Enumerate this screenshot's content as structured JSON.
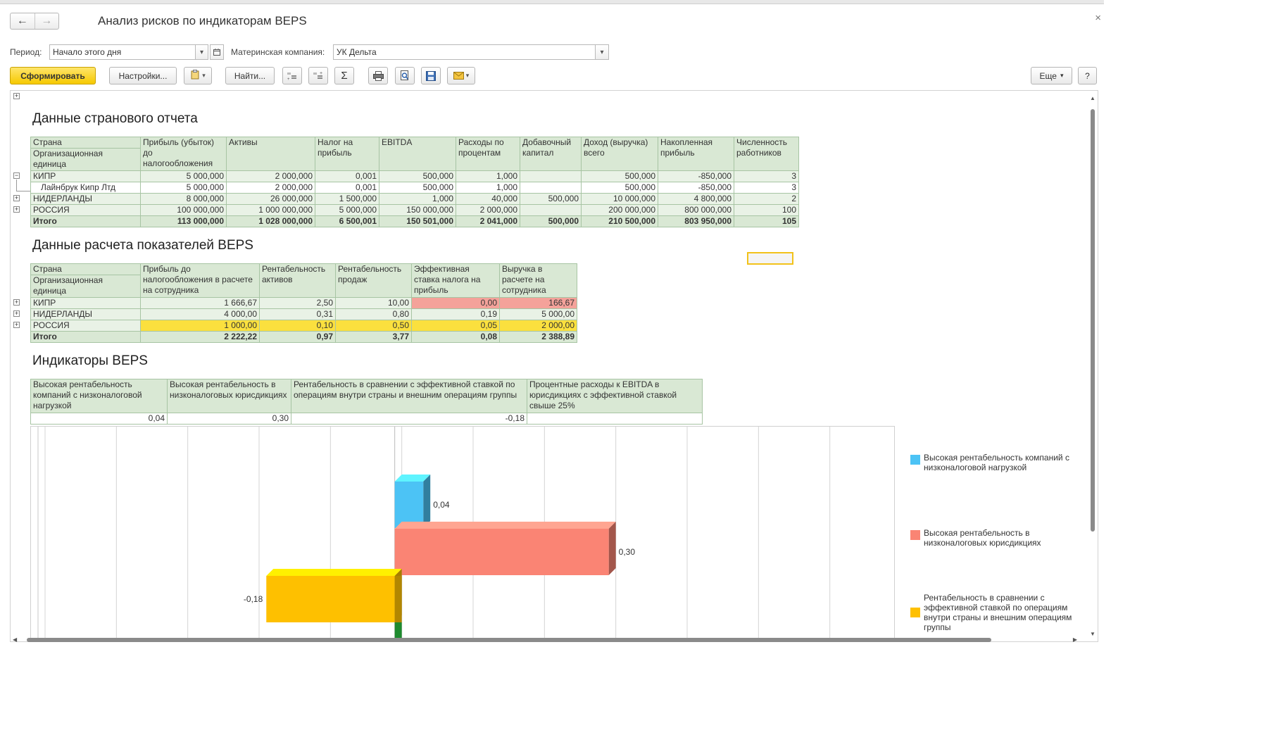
{
  "window": {
    "title": "Анализ рисков по индикаторам BEPS",
    "back_icon": "arrow-left",
    "forward_icon": "arrow-right",
    "close_glyph": "×"
  },
  "params": {
    "period_label": "Период:",
    "period_value": "Начало этого дня",
    "parent_label": "Материнская компания:",
    "parent_value": "УК Дельта"
  },
  "toolbar": {
    "generate": "Сформировать",
    "settings": "Настройки...",
    "find": "Найти...",
    "sum": "Σ",
    "more": "Еще",
    "help": "?"
  },
  "section1": {
    "title": "Данные странового отчета",
    "header_country": "Страна",
    "header_unit": "Организационная единица",
    "columns": [
      "Прибыль (убыток) до налогообложения",
      "Активы",
      "Налог на прибыль",
      "EBITDA",
      "Расходы по процентам",
      "Добавочный капитал",
      "Доход (выручка) всего",
      "Накопленная прибыль",
      "Численность работников"
    ],
    "rows": [
      {
        "name": "КИПР",
        "values": [
          "5 000,000",
          "2 000,000",
          "0,001",
          "500,000",
          "1,000",
          "",
          "500,000",
          "-850,000",
          "3"
        ]
      },
      {
        "name": "Лайнбрук Кипр Лтд",
        "values": [
          "5 000,000",
          "2 000,000",
          "0,001",
          "500,000",
          "1,000",
          "",
          "500,000",
          "-850,000",
          "3"
        ]
      },
      {
        "name": "НИДЕРЛАНДЫ",
        "values": [
          "8 000,000",
          "26 000,000",
          "1 500,000",
          "1,000",
          "40,000",
          "500,000",
          "10 000,000",
          "4 800,000",
          "2"
        ]
      },
      {
        "name": "РОССИЯ",
        "values": [
          "100 000,000",
          "1 000 000,000",
          "5 000,000",
          "150 000,000",
          "2 000,000",
          "",
          "200 000,000",
          "800 000,000",
          "100"
        ]
      }
    ],
    "total": {
      "name": "Итого",
      "values": [
        "113 000,000",
        "1 028 000,000",
        "6 500,001",
        "150 501,000",
        "2 041,000",
        "500,000",
        "210 500,000",
        "803 950,000",
        "105"
      ]
    }
  },
  "section2": {
    "title": "Данные расчета показателей BEPS",
    "header_country": "Страна",
    "header_unit": "Организационная единица",
    "columns": [
      "Прибыль до налогообложения в расчете на сотрудника",
      "Рентабельность активов",
      "Рентабельность продаж",
      "Эффективная ставка налога на прибыль",
      "Выручка в расчете на сотрудника"
    ],
    "rows": [
      {
        "name": "КИПР",
        "values": [
          "1 666,67",
          "2,50",
          "10,00",
          "0,00",
          "166,67"
        ]
      },
      {
        "name": "НИДЕРЛАНДЫ",
        "values": [
          "4 000,00",
          "0,31",
          "0,80",
          "0,19",
          "5 000,00"
        ]
      },
      {
        "name": "РОССИЯ",
        "values": [
          "1 000,00",
          "0,10",
          "0,50",
          "0,05",
          "2 000,00"
        ]
      }
    ],
    "total": {
      "name": "Итого",
      "values": [
        "2 222,22",
        "0,97",
        "3,77",
        "0,08",
        "2 388,89"
      ]
    },
    "highlight_colors": {
      "red": "#f4a29a",
      "yellow": "#fbe03e"
    }
  },
  "section3": {
    "title": "Индикаторы BEPS",
    "columns": [
      "Высокая рентабельность компаний с низконалоговой нагрузкой",
      "Высокая рентабельность в низконалоговых юрисдикциях",
      "Рентабельность в сравнении с эффективной ставкой по операциям внутри страны и внешним операциям группы",
      "Процентные расходы к EBITDA в юрисдикциях с эффективной ставкой свыше 25%"
    ],
    "values": [
      "0,04",
      "0,30",
      "-0,18",
      ""
    ]
  },
  "chart_data": {
    "type": "bar",
    "orientation": "horizontal",
    "style": "3d",
    "xlim": [
      -0.5,
      0.7
    ],
    "grid": true,
    "legend_position": "right",
    "series": [
      {
        "name": "Высокая рентабельность компаний с низконалоговой нагрузкой",
        "value": 0.04,
        "label": "0,04",
        "color": "#4cc3f5"
      },
      {
        "name": "Высокая рентабельность в низконалоговых юрисдикциях",
        "value": 0.3,
        "label": "0,30",
        "color": "#fa8474"
      },
      {
        "name": "Рентабельность в сравнении с эффективной ставкой по операциям внутри страны и внешним операциям группы",
        "value": -0.18,
        "label": "-0,18",
        "color": "#fec000"
      },
      {
        "value": 0.0,
        "color": "#1e8a2e"
      }
    ]
  }
}
